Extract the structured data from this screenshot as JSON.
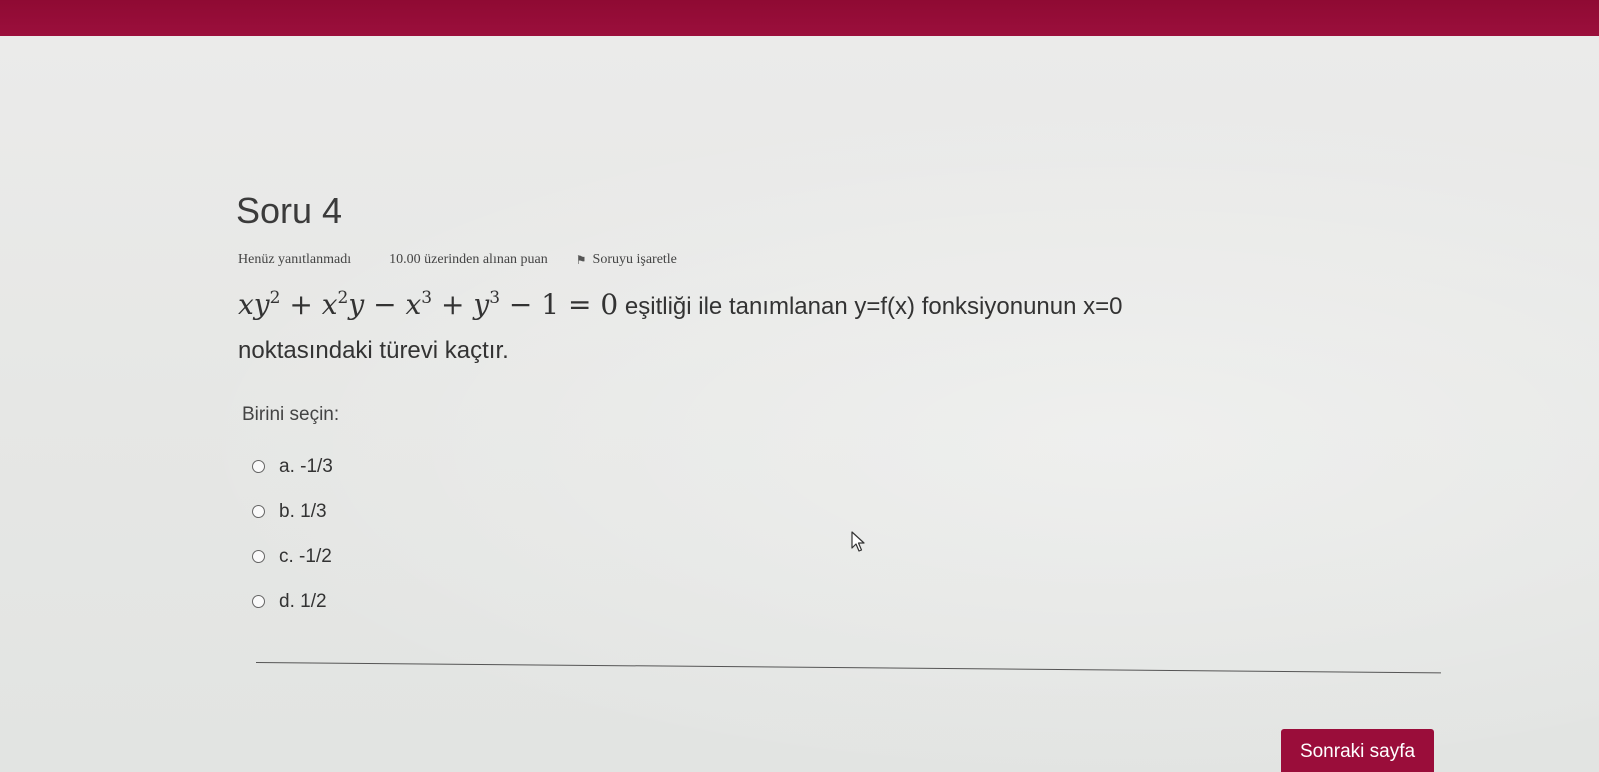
{
  "question": {
    "title": "Soru 4",
    "status": "Henüz yanıtlanmadı",
    "points": "10.00 üzerinden alınan puan",
    "flag_label": "Soruyu işaretle",
    "equation": {
      "t1": "xy",
      "e1": "2",
      "op1": "+",
      "t2a": "x",
      "e2": "2",
      "t2b": "y",
      "op2": "−",
      "t3": "x",
      "e3": "3",
      "op3": "+",
      "t4": "y",
      "e4": "3",
      "op4": "−",
      "c1": "1",
      "eq": "=",
      "c2": "0"
    },
    "text_after_equation": "eşitliği ile tanımlanan y=f(x) fonksiyonunun x=0",
    "text_line2": "noktasındaki türevi kaçtır.",
    "choose_label": "Birini seçin:",
    "options": [
      {
        "label": "a. -1/3"
      },
      {
        "label": "b. 1/3"
      },
      {
        "label": "c. -1/2"
      },
      {
        "label": "d. 1/2"
      }
    ]
  },
  "navigation": {
    "next_button": "Sonraki sayfa"
  },
  "colors": {
    "top_bar": "#9b0f3c",
    "next_button": "#9a0d3a",
    "background": "#e9eae8"
  }
}
